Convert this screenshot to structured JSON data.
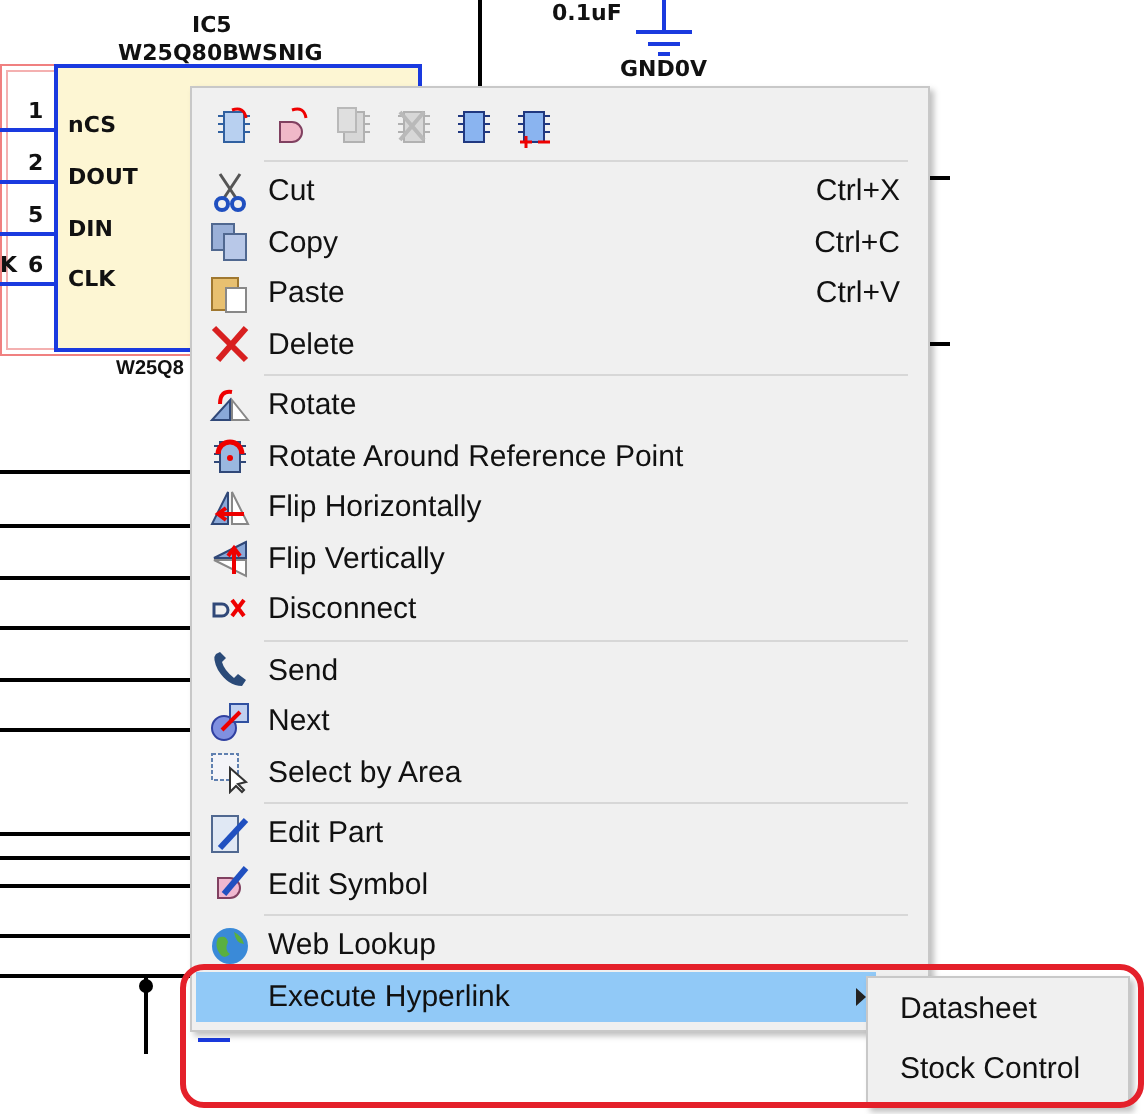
{
  "schematic": {
    "capacitor_value": "0.1uF",
    "ground_label": "GND0V",
    "left_label": "K",
    "component": {
      "ref": "IC5",
      "part": "W25Q80BWSNIG",
      "bottom_label": "W25Q8",
      "pins": [
        {
          "number": "1",
          "name": "nCS"
        },
        {
          "number": "2",
          "name": "DOUT"
        },
        {
          "number": "5",
          "name": "DIN"
        },
        {
          "number": "6",
          "name": "CLK"
        }
      ]
    }
  },
  "context_menu": {
    "toolbar": [
      {
        "disabled": false
      },
      {
        "disabled": false
      },
      {
        "disabled": true
      },
      {
        "disabled": true
      },
      {
        "disabled": false
      },
      {
        "disabled": false
      }
    ],
    "sections": [
      [
        {
          "label": "Cut",
          "shortcut": "Ctrl+X",
          "selected": false
        },
        {
          "label": "Copy",
          "shortcut": "Ctrl+C",
          "selected": false
        },
        {
          "label": "Paste",
          "shortcut": "Ctrl+V",
          "selected": false
        },
        {
          "label": "Delete",
          "selected": false
        }
      ],
      [
        {
          "label": "Rotate",
          "selected": false
        },
        {
          "label": "Rotate Around Reference Point",
          "selected": false
        },
        {
          "label": "Flip Horizontally",
          "selected": false
        },
        {
          "label": "Flip Vertically",
          "selected": false
        },
        {
          "label": "Disconnect",
          "selected": false
        }
      ],
      [
        {
          "label": "Send",
          "selected": false
        },
        {
          "label": "Next",
          "selected": false
        },
        {
          "label": "Select by Area",
          "selected": false
        }
      ],
      [
        {
          "label": "Edit Part",
          "selected": false
        },
        {
          "label": "Edit Symbol",
          "selected": false
        }
      ],
      [
        {
          "label": "Web Lookup",
          "selected": false
        },
        {
          "label": "Execute Hyperlink",
          "selected": true,
          "has_submenu": true
        }
      ]
    ],
    "submenu": [
      {
        "label": "Datasheet",
        "selected": false
      },
      {
        "label": "Stock Control",
        "selected": false
      }
    ]
  }
}
